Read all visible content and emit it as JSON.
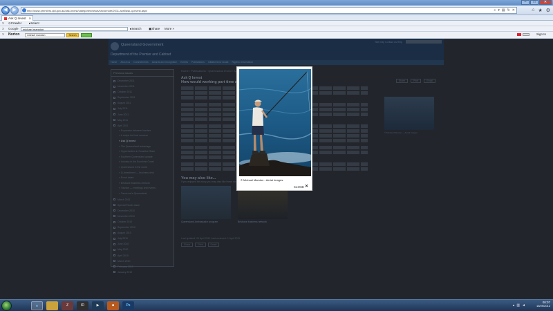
{
  "browser": {
    "url": "http://www.premiers.qld.gov.au/ask-invest/categories/news/sectornote/2011-april/ask-q-invest.aspx",
    "tab_title": "Ask Q Invest",
    "toolbar1": {
      "close": "X",
      "crawler": "Crawler",
      "select": "Select"
    },
    "toolbar2": {
      "close": "X",
      "google_label": "Google",
      "search_value": "michael manston",
      "search_btn": "Search",
      "share": "Share",
      "more": "More »"
    },
    "toolbar3": {
      "close": "X",
      "norton": "Norton",
      "search_value": "michael manston",
      "search_btn": "Search",
      "signin": "Sign In"
    }
  },
  "site": {
    "name": "Queensland Government",
    "department": "Department of the Premier and Cabinet",
    "header_links": "Site map   Contact us   Help",
    "nav": [
      "Home",
      "About us",
      "Commitments",
      "Awards and recognition",
      "Events",
      "Publications",
      "Initiatives for locals",
      "Right to Information"
    ]
  },
  "sidebar": {
    "title": "Previous issues",
    "items": [
      {
        "label": "December 2011",
        "sub": false
      },
      {
        "label": "November 2011",
        "sub": false
      },
      {
        "label": "October 2011",
        "sub": false
      },
      {
        "label": "September 2011",
        "sub": false
      },
      {
        "label": "August 2011",
        "sub": false
      },
      {
        "label": "July 2011",
        "sub": false
      },
      {
        "label": "June 2011",
        "sub": false
      },
      {
        "label": "May 2011",
        "sub": false
      },
      {
        "label": "April 2011",
        "sub": false
      },
      {
        "label": "Expansion between borders",
        "sub": true
      },
      {
        "label": "A recipe for food success",
        "sub": true
      },
      {
        "label": "Ask Q Invest",
        "sub": true,
        "current": true
      },
      {
        "label": "The Queensland advantage",
        "sub": true
      },
      {
        "label": "Opportunities in Sunshine State",
        "sub": true
      },
      {
        "label": "Southern Queensland update",
        "sub": true
      },
      {
        "label": "Industry in the Sunshine Coast",
        "sub": true
      },
      {
        "label": "Queensland in the world",
        "sub": true
      },
      {
        "label": "Q-Investment — business deal",
        "sub": true
      },
      {
        "label": "Event dates",
        "sub": true
      },
      {
        "label": "Brisbane business network",
        "sub": true
      },
      {
        "label": "Tourism — meetings and events",
        "sub": true
      },
      {
        "label": "Tomorrow's Queensland",
        "sub": true
      },
      {
        "label": "March 2011",
        "sub": false
      },
      {
        "label": "Special Floods issue",
        "sub": false
      },
      {
        "label": "December 2010",
        "sub": false
      },
      {
        "label": "November 2010",
        "sub": false
      },
      {
        "label": "October 2010",
        "sub": false
      },
      {
        "label": "September 2010",
        "sub": false
      },
      {
        "label": "August 2010",
        "sub": false
      },
      {
        "label": "July 2010",
        "sub": false
      },
      {
        "label": "June 2010",
        "sub": false
      },
      {
        "label": "May 2010",
        "sub": false
      },
      {
        "label": "April 2010",
        "sub": false
      },
      {
        "label": "March 2010",
        "sub": false
      },
      {
        "label": "February 2010",
        "sub": false
      },
      {
        "label": "January 2010",
        "sub": false
      }
    ]
  },
  "article": {
    "crumb": "Home  ›  Publications  ›  Queensland Invest  ›  April 2011  ›  Ask Q Invest",
    "kicker": "Ask Q Invest",
    "title": "How would working part time affect my finances?",
    "tools": [
      "Share",
      "Print",
      "Email"
    ],
    "side_caption": "© Michael Marston — Aerial Images",
    "also_title": "You may also like...",
    "also_sub": "If you enjoyed this story you may also like these stories from this month's Queensland Invest.",
    "thumbs": [
      {
        "caption": "Queensland Ambassador program"
      },
      {
        "caption": "Brisbane business network"
      }
    ],
    "last_updated": "Last updated:  26 April 2011     Last reviewed:  1 April 2011",
    "share_buttons": [
      "Share",
      "Print",
      "Email"
    ]
  },
  "lightbox": {
    "caption": "© Michael Marston - Aerial Images.",
    "close_label": "CLOSE"
  },
  "taskbar": {
    "apps": [
      "e",
      "📁",
      "Z",
      "ID",
      "▶",
      "■",
      "Ps"
    ],
    "time": "08:07",
    "date": "15/09/2012"
  },
  "colors": {
    "overlay_dim": "#22262c",
    "site_blue": "#1b2d44",
    "taskbar": "#1e3556"
  }
}
